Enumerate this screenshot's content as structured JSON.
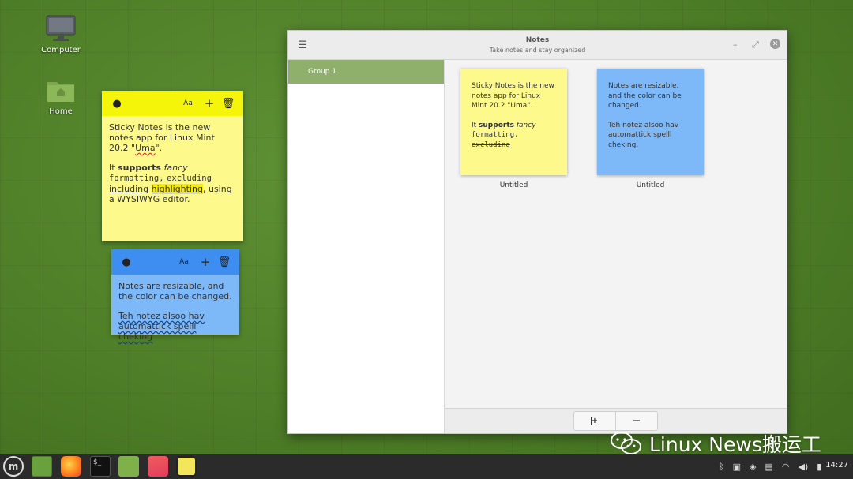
{
  "desktop": {
    "icons": [
      {
        "label": "Computer",
        "icon": "computer-icon"
      },
      {
        "label": "Home",
        "icon": "home-folder-icon"
      }
    ]
  },
  "sticky_yellow": {
    "color": "#fdf98b",
    "bar_color": "#f5f50a",
    "para1_a": "Sticky Notes is the new notes app for Linux Mint 20.2 \"",
    "para1_b": "Uma",
    "para1_c": "\".",
    "it": "It ",
    "supports": "supports",
    "fancy": "fancy",
    "formatting": "formatting,",
    "excluding": "excluding",
    "including": "including",
    "highlighting": "highlighting",
    "tail": ", using a WYSIWYG editor."
  },
  "sticky_blue": {
    "color": "#7db8f8",
    "bar_color": "#3d8ef0",
    "para1": "Notes are resizable, and the color can be changed.",
    "para2": "Teh notez alsoo hav automattick spelll cheking"
  },
  "notes_window": {
    "title": "Notes",
    "subtitle": "Take notes and stay organized",
    "menu_icon": "hamburger-menu-icon",
    "groups": [
      "Group 1"
    ],
    "notes": [
      {
        "label": "Untitled",
        "color": "#fdf98b",
        "p1": "Sticky Notes is the new notes app for Linux Mint 20.2 \"Uma\".",
        "it": "It ",
        "supports": "supports",
        "fancy": "fancy",
        "formatting": "formatting,",
        "excluding": "excluding"
      },
      {
        "label": "Untitled",
        "color": "#7db8f8",
        "p1": "Notes are resizable, and the color can be changed.",
        "p2": "Teh notez alsoo hav automattick spelll cheking."
      }
    ],
    "add_button": "+",
    "remove_button": "−"
  },
  "taskbar": {
    "apps": [
      "mint-menu-icon",
      "show-desktop-icon",
      "firefox-icon",
      "terminal-icon",
      "files-icon",
      "image-viewer-icon",
      "sticky-notes-icon"
    ],
    "clock": "14:27"
  },
  "watermark": "Linux News搬运工"
}
